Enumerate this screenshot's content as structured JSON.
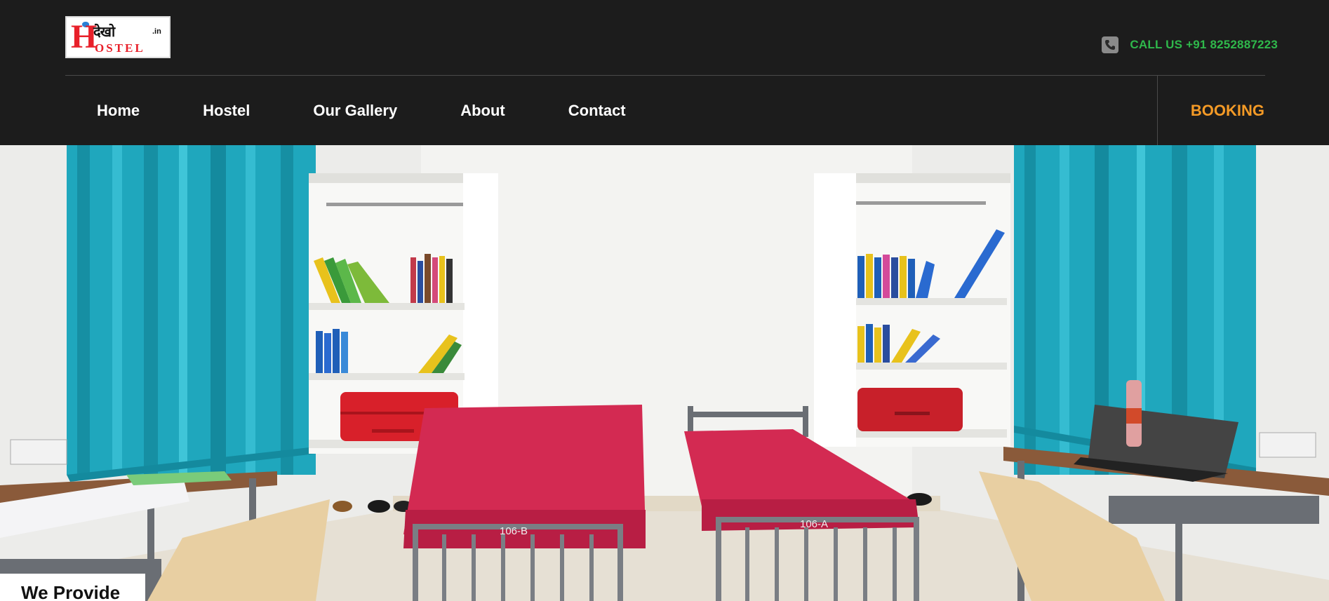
{
  "brand": {
    "logo_hindi": "देखो",
    "logo_suffix": ".in",
    "logo_h": "H",
    "logo_ostel": "OSTEL"
  },
  "contact": {
    "icon": "phone-icon",
    "text": "CALL US +91 8252887223",
    "color": "#2fb84b"
  },
  "nav": {
    "items": [
      {
        "label": "Home"
      },
      {
        "label": "Hostel"
      },
      {
        "label": "Our Gallery"
      },
      {
        "label": "About"
      },
      {
        "label": "Contact"
      }
    ],
    "booking_label": "BOOKING",
    "booking_color": "#f49a26"
  },
  "hero": {
    "bed_label_left": "106-B",
    "bed_label_right": "106-A"
  },
  "section": {
    "we_provide": "We Provide"
  }
}
